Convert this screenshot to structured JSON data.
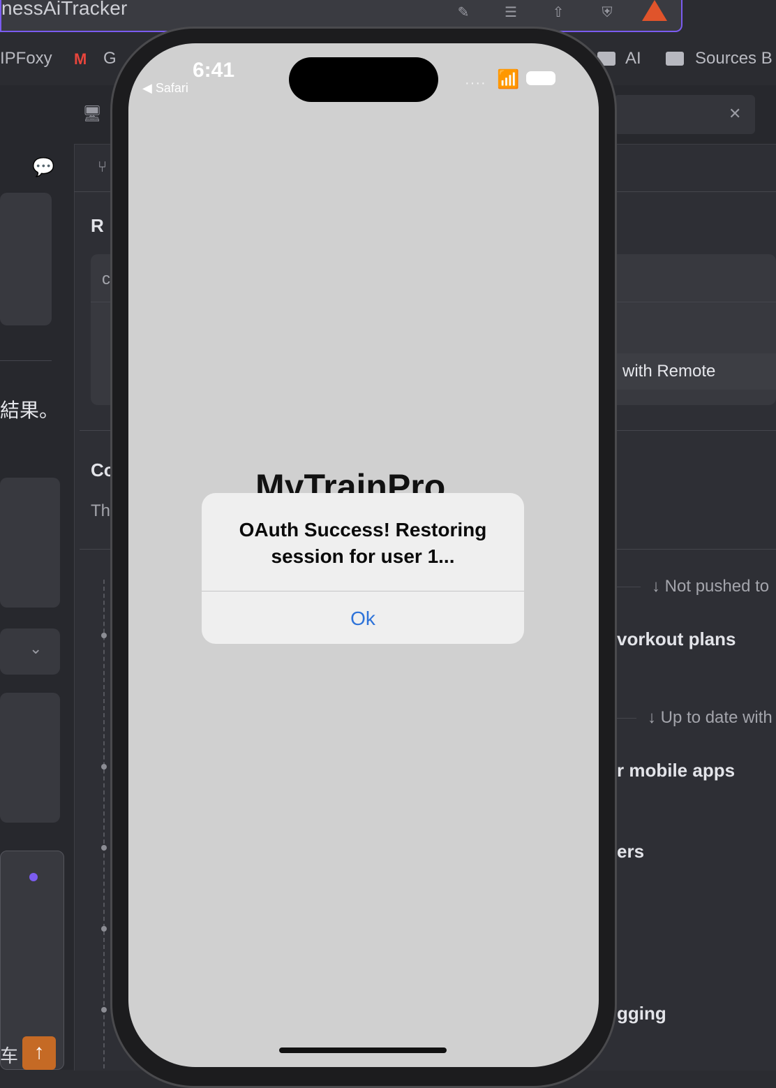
{
  "window": {
    "title": "nessAiTracker"
  },
  "bookmarks": [
    {
      "label": "IPFoxy"
    },
    {
      "label": "G"
    },
    {
      "label": "AI"
    },
    {
      "label": "Sources B"
    }
  ],
  "background": {
    "cjk_text": "結果。",
    "panel_letter_r": "R",
    "panel_letter_c": "c",
    "panel_letter_co": "Co",
    "panel_letter_th": "Th",
    "remote_label": "with Remote",
    "not_pushed": "Not pushed to",
    "workout_plans": "vorkout plans",
    "up_to_date": "Up to date with",
    "mobile_apps": "r mobile apps",
    "ers": "ers",
    "gging": "gging",
    "bottom_left_char": "车"
  },
  "phone": {
    "status": {
      "time": "6:41",
      "back_app": "◀ Safari"
    },
    "app_title": "MyTrainPro",
    "alert": {
      "message": "OAuth Success! Restoring session for user 1...",
      "ok_label": "Ok"
    }
  }
}
